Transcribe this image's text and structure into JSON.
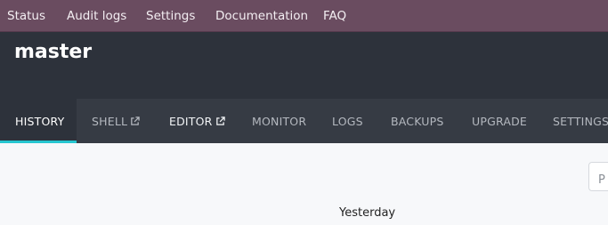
{
  "topnav": {
    "items": [
      "Status",
      "Audit logs",
      "Settings",
      "Documentation",
      "FAQ"
    ]
  },
  "header": {
    "title": "master"
  },
  "tabs": [
    {
      "label": "HISTORY",
      "active": true,
      "external": false
    },
    {
      "label": "SHELL",
      "active": false,
      "external": true
    },
    {
      "label": "EDITOR",
      "active": false,
      "external": true
    },
    {
      "label": "MONITOR",
      "active": false,
      "external": false
    },
    {
      "label": "LOGS",
      "active": false,
      "external": false
    },
    {
      "label": "BACKUPS",
      "active": false,
      "external": false
    },
    {
      "label": "UPGRADE",
      "active": false,
      "external": false
    },
    {
      "label": "SETTINGS",
      "active": false,
      "external": false
    }
  ],
  "content": {
    "search_value": "P",
    "date_label": "Yesterday"
  },
  "colors": {
    "topnav_bg": "#6a4c60",
    "header_bg": "#2d323b",
    "tabbar_bg": "#363b44",
    "active_underline": "#26c6d0"
  }
}
